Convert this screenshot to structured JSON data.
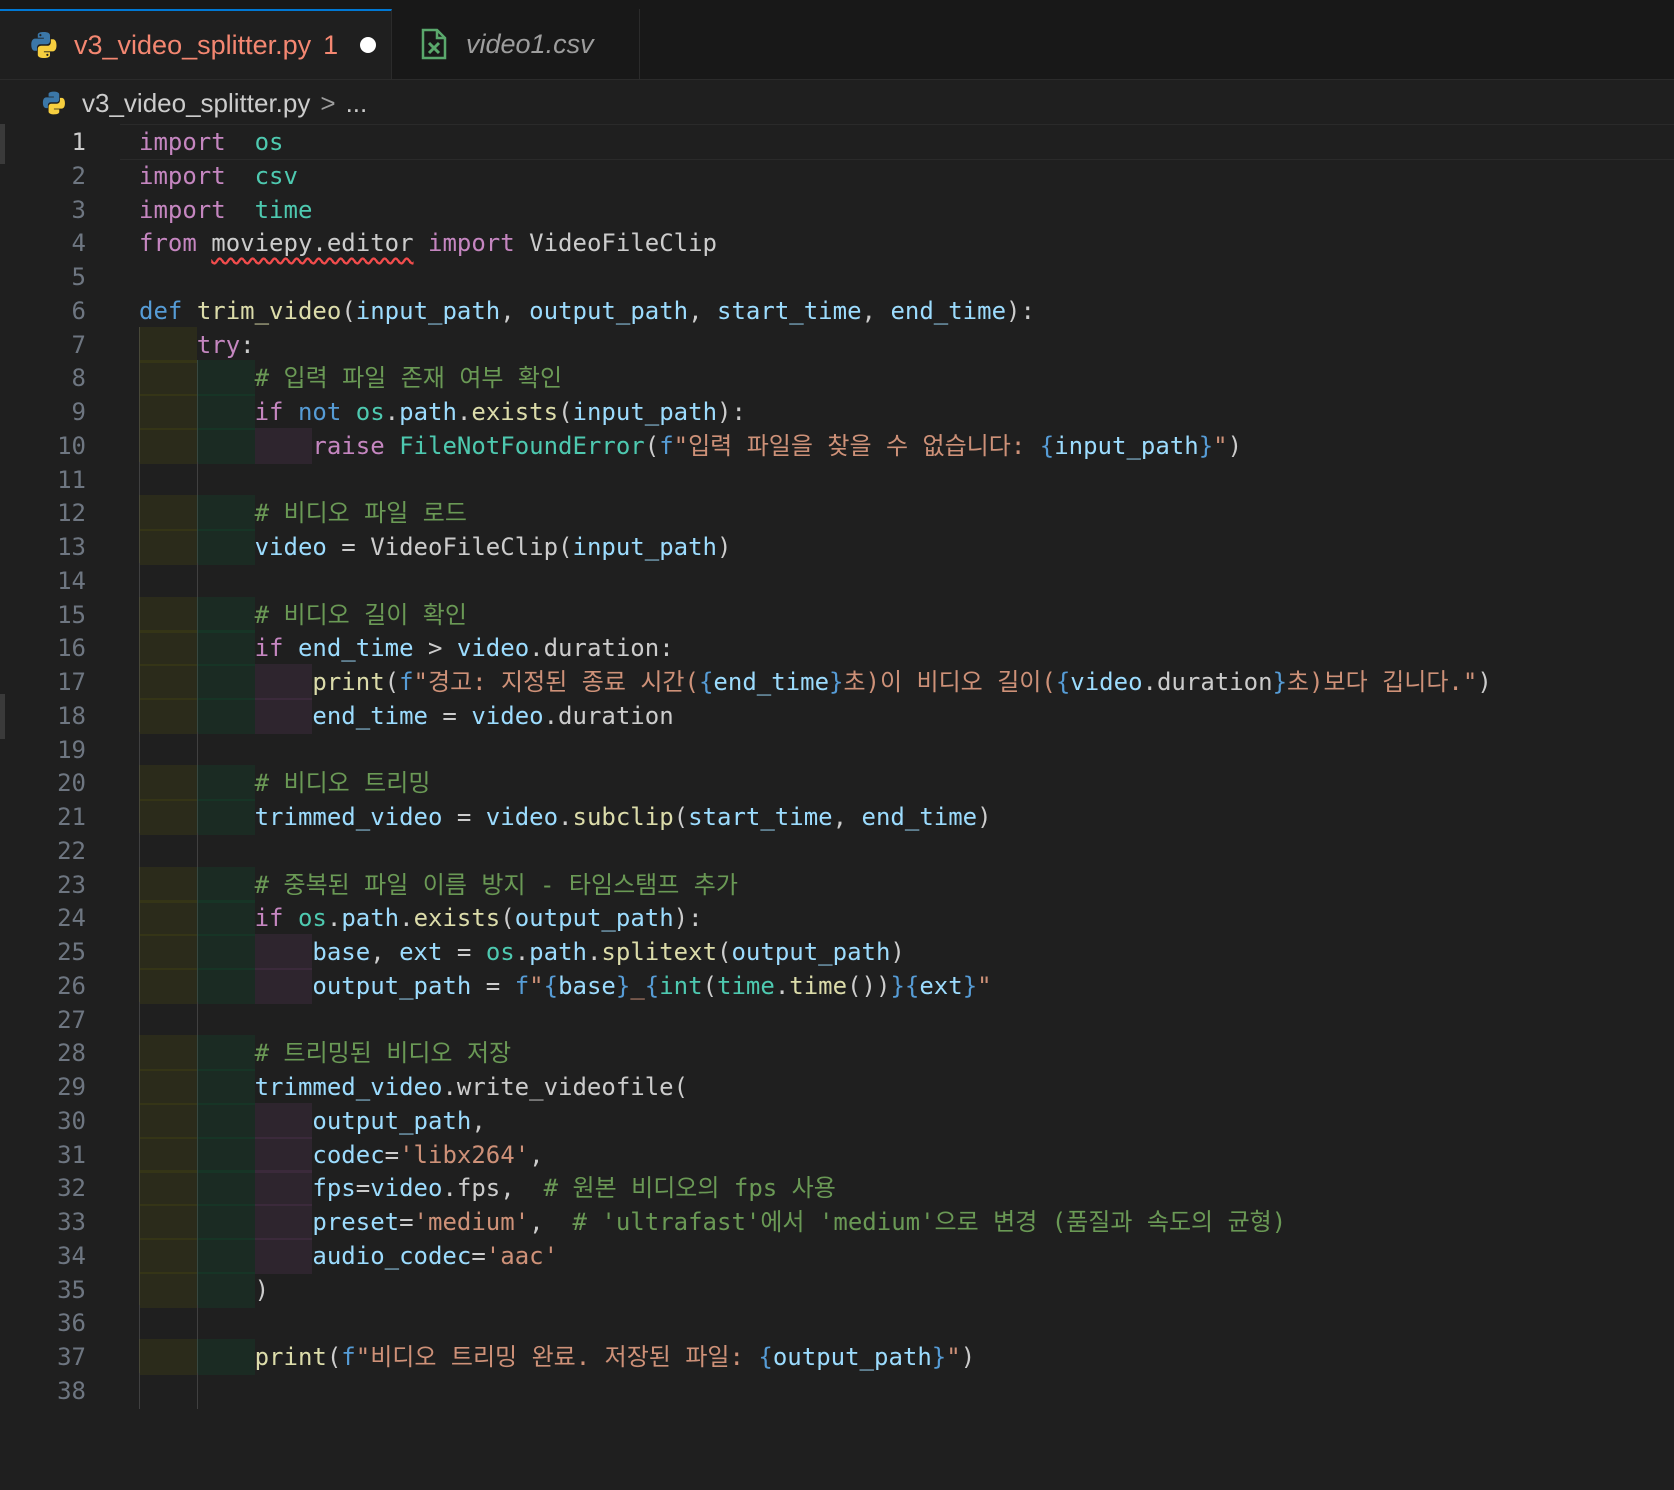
{
  "tabs": [
    {
      "label": "v3_video_splitter.py",
      "badge": "1",
      "icon": "python-icon",
      "active": true,
      "dirty": true
    },
    {
      "label": "video1.csv",
      "icon": "csv-file-icon",
      "active": false
    }
  ],
  "breadcrumb": {
    "file": "v3_video_splitter.py",
    "separator": ">",
    "more": "..."
  },
  "editor": {
    "active_line": 1,
    "lines": [
      {
        "n": "1",
        "indent": 0,
        "tokens": [
          [
            "kw",
            "import"
          ],
          [
            "",
            "  "
          ],
          [
            "mod",
            "os"
          ]
        ]
      },
      {
        "n": "2",
        "indent": 0,
        "tokens": [
          [
            "kw",
            "import"
          ],
          [
            "",
            "  "
          ],
          [
            "mod",
            "csv"
          ]
        ]
      },
      {
        "n": "3",
        "indent": 0,
        "tokens": [
          [
            "kw",
            "import"
          ],
          [
            "",
            "  "
          ],
          [
            "mod",
            "time"
          ]
        ]
      },
      {
        "n": "4",
        "indent": 0,
        "tokens": [
          [
            "kw",
            "from"
          ],
          [
            "",
            " "
          ],
          [
            "sq",
            "moviepy.editor"
          ],
          [
            "",
            " "
          ],
          [
            "kw",
            "import"
          ],
          [
            "",
            " VideoFileClip"
          ]
        ]
      },
      {
        "n": "5",
        "indent": 0,
        "tokens": []
      },
      {
        "n": "6",
        "indent": 0,
        "tokens": [
          [
            "kw2",
            "def"
          ],
          [
            "",
            " "
          ],
          [
            "fn",
            "trim_video"
          ],
          [
            "",
            "("
          ],
          [
            "var",
            "input_path"
          ],
          [
            "",
            ", "
          ],
          [
            "var",
            "output_path"
          ],
          [
            "",
            ", "
          ],
          [
            "var",
            "start_time"
          ],
          [
            "",
            ", "
          ],
          [
            "var",
            "end_time"
          ],
          [
            "",
            "):"
          ]
        ]
      },
      {
        "n": "7",
        "indent": 1,
        "tokens": [
          [
            "kw",
            "try"
          ],
          [
            "",
            ":"
          ]
        ]
      },
      {
        "n": "8",
        "indent": 2,
        "tokens": [
          [
            "cm",
            "# 입력 파일 존재 여부 확인"
          ]
        ]
      },
      {
        "n": "9",
        "indent": 2,
        "tokens": [
          [
            "kw",
            "if"
          ],
          [
            "",
            " "
          ],
          [
            "kw2",
            "not"
          ],
          [
            "",
            " "
          ],
          [
            "mod",
            "os"
          ],
          [
            "",
            "."
          ],
          [
            "var",
            "path"
          ],
          [
            "",
            "."
          ],
          [
            "fn",
            "exists"
          ],
          [
            "",
            "("
          ],
          [
            "var",
            "input_path"
          ],
          [
            "",
            "):"
          ]
        ]
      },
      {
        "n": "10",
        "indent": 3,
        "tokens": [
          [
            "kw",
            "raise"
          ],
          [
            "",
            " "
          ],
          [
            "mod",
            "FileNotFoundError"
          ],
          [
            "",
            "("
          ],
          [
            "kw2",
            "f"
          ],
          [
            "str",
            "\"입력 파일을 찾을 수 없습니다: "
          ],
          [
            "brace",
            "{"
          ],
          [
            "var",
            "input_path"
          ],
          [
            "brace",
            "}"
          ],
          [
            "str",
            "\""
          ],
          [
            "",
            ")"
          ]
        ]
      },
      {
        "n": "11",
        "indent": 0,
        "tokens": []
      },
      {
        "n": "12",
        "indent": 2,
        "tokens": [
          [
            "cm",
            "# 비디오 파일 로드"
          ]
        ]
      },
      {
        "n": "13",
        "indent": 2,
        "tokens": [
          [
            "var",
            "video"
          ],
          [
            "",
            " = "
          ],
          [
            "",
            "VideoFileClip("
          ],
          [
            "var",
            "input_path"
          ],
          [
            "",
            ")"
          ]
        ]
      },
      {
        "n": "14",
        "indent": 0,
        "tokens": []
      },
      {
        "n": "15",
        "indent": 2,
        "tokens": [
          [
            "cm",
            "# 비디오 길이 확인"
          ]
        ]
      },
      {
        "n": "16",
        "indent": 2,
        "tokens": [
          [
            "kw",
            "if"
          ],
          [
            "",
            " "
          ],
          [
            "var",
            "end_time"
          ],
          [
            "",
            " > "
          ],
          [
            "var",
            "video"
          ],
          [
            "",
            ".duration:"
          ]
        ]
      },
      {
        "n": "17",
        "indent": 3,
        "tokens": [
          [
            "fn",
            "print"
          ],
          [
            "",
            "("
          ],
          [
            "kw2",
            "f"
          ],
          [
            "str",
            "\"경고: 지정된 종료 시간("
          ],
          [
            "brace",
            "{"
          ],
          [
            "var",
            "end_time"
          ],
          [
            "brace",
            "}"
          ],
          [
            "str",
            "초)이 비디오 길이("
          ],
          [
            "brace",
            "{"
          ],
          [
            "var",
            "video"
          ],
          [
            "",
            ".duration"
          ],
          [
            "brace",
            "}"
          ],
          [
            "str",
            "초)보다 깁니다.\""
          ],
          [
            "",
            ")"
          ]
        ]
      },
      {
        "n": "18",
        "indent": 3,
        "tokens": [
          [
            "var",
            "end_time"
          ],
          [
            "",
            " = "
          ],
          [
            "var",
            "video"
          ],
          [
            "",
            ".duration"
          ]
        ]
      },
      {
        "n": "19",
        "indent": 0,
        "tokens": []
      },
      {
        "n": "20",
        "indent": 2,
        "tokens": [
          [
            "cm",
            "# 비디오 트리밍"
          ]
        ]
      },
      {
        "n": "21",
        "indent": 2,
        "tokens": [
          [
            "var",
            "trimmed_video"
          ],
          [
            "",
            " = "
          ],
          [
            "var",
            "video"
          ],
          [
            "",
            "."
          ],
          [
            "fn",
            "subclip"
          ],
          [
            "",
            "("
          ],
          [
            "var",
            "start_time"
          ],
          [
            "",
            ", "
          ],
          [
            "var",
            "end_time"
          ],
          [
            "",
            ")"
          ]
        ]
      },
      {
        "n": "22",
        "indent": 0,
        "tokens": []
      },
      {
        "n": "23",
        "indent": 2,
        "tokens": [
          [
            "cm",
            "# 중복된 파일 이름 방지 - 타임스탬프 추가"
          ]
        ]
      },
      {
        "n": "24",
        "indent": 2,
        "tokens": [
          [
            "kw",
            "if"
          ],
          [
            "",
            " "
          ],
          [
            "mod",
            "os"
          ],
          [
            "",
            "."
          ],
          [
            "var",
            "path"
          ],
          [
            "",
            "."
          ],
          [
            "fn",
            "exists"
          ],
          [
            "",
            "("
          ],
          [
            "var",
            "output_path"
          ],
          [
            "",
            "):"
          ]
        ]
      },
      {
        "n": "25",
        "indent": 3,
        "tokens": [
          [
            "var",
            "base"
          ],
          [
            "",
            ", "
          ],
          [
            "var",
            "ext"
          ],
          [
            "",
            " = "
          ],
          [
            "mod",
            "os"
          ],
          [
            "",
            "."
          ],
          [
            "var",
            "path"
          ],
          [
            "",
            "."
          ],
          [
            "fn",
            "splitext"
          ],
          [
            "",
            "("
          ],
          [
            "var",
            "output_path"
          ],
          [
            "",
            ")"
          ]
        ]
      },
      {
        "n": "26",
        "indent": 3,
        "tokens": [
          [
            "var",
            "output_path"
          ],
          [
            "",
            " = "
          ],
          [
            "kw2",
            "f"
          ],
          [
            "str",
            "\""
          ],
          [
            "brace",
            "{"
          ],
          [
            "var",
            "base"
          ],
          [
            "brace",
            "}"
          ],
          [
            "str",
            "_"
          ],
          [
            "brace",
            "{"
          ],
          [
            "mod",
            "int"
          ],
          [
            "",
            "("
          ],
          [
            "mod",
            "time"
          ],
          [
            "",
            "."
          ],
          [
            "fn",
            "time"
          ],
          [
            "",
            "())"
          ],
          [
            "brace",
            "}{"
          ],
          [
            "var",
            "ext"
          ],
          [
            "brace",
            "}"
          ],
          [
            "str",
            "\""
          ]
        ]
      },
      {
        "n": "27",
        "indent": 0,
        "tokens": []
      },
      {
        "n": "28",
        "indent": 2,
        "tokens": [
          [
            "cm",
            "# 트리밍된 비디오 저장"
          ]
        ]
      },
      {
        "n": "29",
        "indent": 2,
        "tokens": [
          [
            "var",
            "trimmed_video"
          ],
          [
            "",
            ".write_videofile("
          ]
        ]
      },
      {
        "n": "30",
        "indent": 3,
        "tokens": [
          [
            "var",
            "output_path"
          ],
          [
            "",
            ","
          ]
        ]
      },
      {
        "n": "31",
        "indent": 3,
        "tokens": [
          [
            "var",
            "codec"
          ],
          [
            "",
            "="
          ],
          [
            "str",
            "'libx264'"
          ],
          [
            "",
            ","
          ]
        ]
      },
      {
        "n": "32",
        "indent": 3,
        "tokens": [
          [
            "var",
            "fps"
          ],
          [
            "",
            "="
          ],
          [
            "var",
            "video"
          ],
          [
            "",
            ".fps,  "
          ],
          [
            "cm",
            "# 원본 비디오의 fps 사용"
          ]
        ]
      },
      {
        "n": "33",
        "indent": 3,
        "tokens": [
          [
            "var",
            "preset"
          ],
          [
            "",
            "="
          ],
          [
            "str",
            "'medium'"
          ],
          [
            "",
            ",  "
          ],
          [
            "cm",
            "# 'ultrafast'에서 'medium'으로 변경 (품질과 속도의 균형)"
          ]
        ]
      },
      {
        "n": "34",
        "indent": 3,
        "tokens": [
          [
            "var",
            "audio_codec"
          ],
          [
            "",
            "="
          ],
          [
            "str",
            "'aac'"
          ]
        ]
      },
      {
        "n": "35",
        "indent": 2,
        "tokens": [
          [
            "",
            ")"
          ]
        ]
      },
      {
        "n": "36",
        "indent": 0,
        "tokens": []
      },
      {
        "n": "37",
        "indent": 2,
        "tokens": [
          [
            "fn",
            "print"
          ],
          [
            "",
            "("
          ],
          [
            "kw2",
            "f"
          ],
          [
            "str",
            "\"비디오 트리밍 완료. 저장된 파일: "
          ],
          [
            "brace",
            "{"
          ],
          [
            "var",
            "output_path"
          ],
          [
            "brace",
            "}"
          ],
          [
            "str",
            "\""
          ],
          [
            "",
            ")"
          ]
        ]
      },
      {
        "n": "38",
        "indent": 0,
        "tokens": []
      }
    ]
  }
}
